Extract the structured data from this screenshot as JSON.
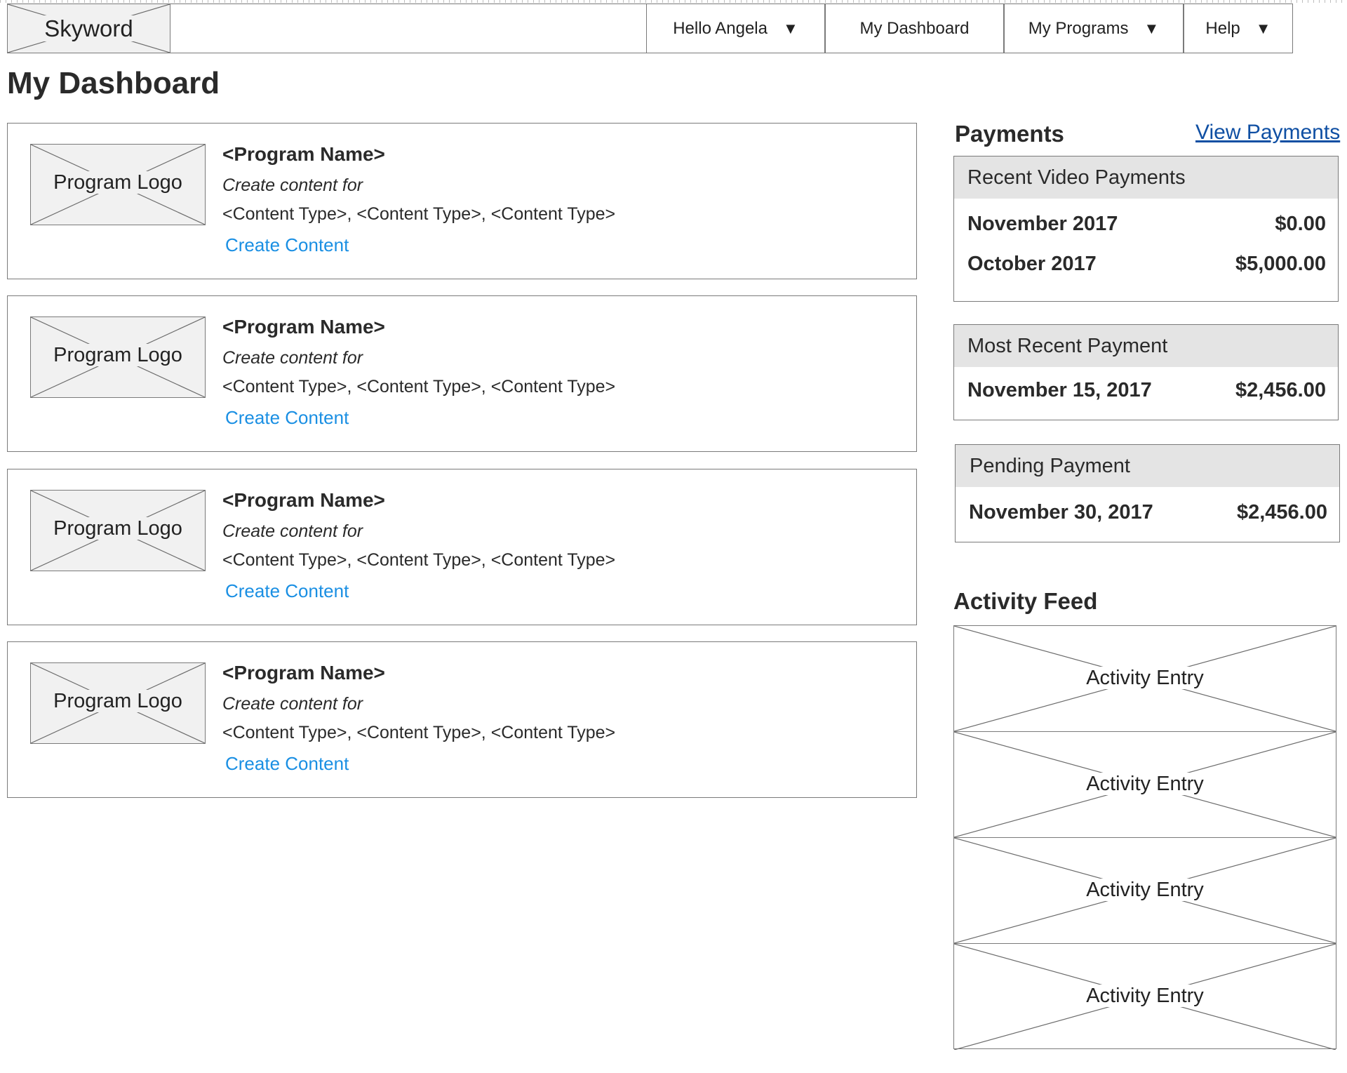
{
  "app": {
    "logo_text": "Skyword"
  },
  "nav": {
    "items": [
      {
        "label": "Hello Angela",
        "has_caret": true
      },
      {
        "label": "My Dashboard",
        "has_caret": false
      },
      {
        "label": "My Programs",
        "has_caret": true
      },
      {
        "label": "Help",
        "has_caret": true
      }
    ],
    "caret_glyph": "▼"
  },
  "page": {
    "title": "My Dashboard"
  },
  "programs": [
    {
      "logo_label": "Program Logo",
      "name": "<Program Name>",
      "subtitle": "Create content for",
      "content_types": "<Content Type>, <Content Type>, <Content Type>",
      "action_label": "Create Content"
    },
    {
      "logo_label": "Program Logo",
      "name": "<Program Name>",
      "subtitle": "Create content for",
      "content_types": "<Content Type>, <Content Type>, <Content Type>",
      "action_label": "Create Content"
    },
    {
      "logo_label": "Program Logo",
      "name": "<Program Name>",
      "subtitle": "Create content for",
      "content_types": "<Content Type>, <Content Type>, <Content Type>",
      "action_label": "Create Content"
    },
    {
      "logo_label": "Program Logo",
      "name": "<Program Name>",
      "subtitle": "Create content for",
      "content_types": "<Content Type>, <Content Type>, <Content Type>",
      "action_label": "Create Content"
    }
  ],
  "payments": {
    "heading": "Payments",
    "view_link": "View Payments",
    "recent_video": {
      "title": "Recent Video Payments",
      "rows": [
        {
          "period": "November 2017",
          "amount": "$0.00"
        },
        {
          "period": "October 2017",
          "amount": "$5,000.00"
        }
      ]
    },
    "most_recent": {
      "title": "Most Recent Payment",
      "date": "November 15, 2017",
      "amount": "$2,456.00"
    },
    "pending": {
      "title": "Pending Payment",
      "date": "November 30, 2017",
      "amount": "$2,456.00"
    }
  },
  "activity": {
    "heading": "Activity Feed",
    "entries": [
      "Activity Entry",
      "Activity Entry",
      "Activity Entry",
      "Activity Entry"
    ]
  },
  "colors": {
    "link_blue": "#1a8fe3",
    "view_link_blue": "#0f4fa3",
    "panel_header_gray": "#e4e4e4",
    "placeholder_gray": "#f1f1f1",
    "border_gray": "#7a7a7a"
  }
}
